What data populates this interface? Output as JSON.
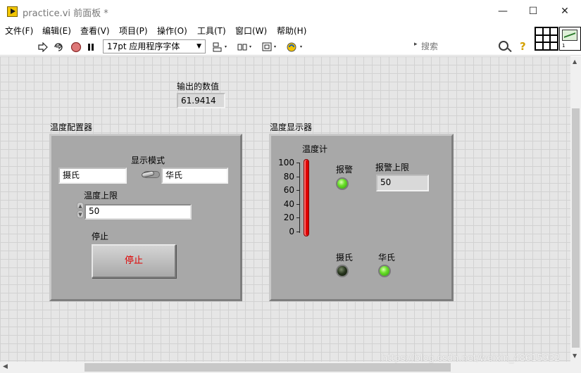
{
  "window": {
    "title": "practice.vi 前面板 *",
    "minimize": "—",
    "maximize": "☐",
    "close": "✕"
  },
  "menu": [
    "文件(F)",
    "编辑(E)",
    "查看(V)",
    "项目(P)",
    "操作(O)",
    "工具(T)",
    "窗口(W)",
    "帮助(H)"
  ],
  "toolbar": {
    "font": "17pt 应用程序字体",
    "search_placeholder": "搜索",
    "help": "?"
  },
  "vi_icon_label": "1",
  "front_panel": {
    "output": {
      "label": "输出的数值",
      "value": "61.9414"
    },
    "config_cluster": {
      "label": "温度配置器",
      "display_mode_label": "显示模式",
      "mode_off_text": "摄氏",
      "mode_on_text": "华氏",
      "upper_limit_label": "温度上限",
      "upper_limit_value": "50",
      "stop_label": "停止",
      "stop_button_text": "停止"
    },
    "display_cluster": {
      "label": "温度显示器",
      "thermometer_label": "温度计",
      "thermometer_ticks": [
        "100",
        "80",
        "60",
        "40",
        "20",
        "0"
      ],
      "thermometer_level_percent": 100,
      "alarm_label": "报警",
      "alarm_state": "on",
      "alarm_limit_label": "报警上限",
      "alarm_limit_value": "50",
      "celsius_label": "摄氏",
      "celsius_state": "off",
      "fahrenheit_label": "华氏",
      "fahrenheit_state": "on"
    }
  },
  "watermark": "https://blog.csdn.net/weixin_48615932",
  "colors": {
    "panel_bg": "#e6e6e6",
    "cluster_bg": "#a8a8a8",
    "led_on": "#6be02a",
    "stop_text": "#e00000",
    "thermometer_fill": "#dd0000"
  }
}
